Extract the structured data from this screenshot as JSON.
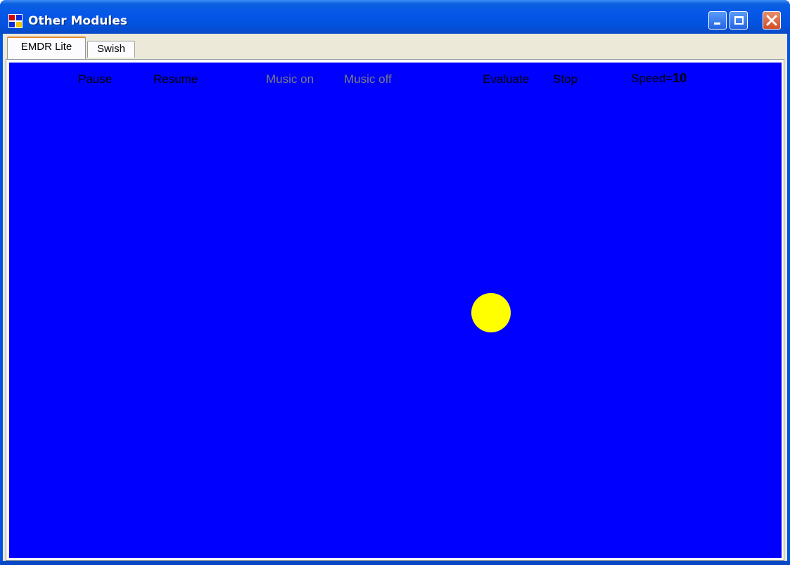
{
  "window": {
    "title": "Other Modules"
  },
  "tabs": [
    {
      "label": "EMDR Lite",
      "selected": true
    },
    {
      "label": "Swish",
      "selected": false
    }
  ],
  "controls": {
    "pause": "Pause",
    "resume": "Resume",
    "music_on": "Music on",
    "music_off": "Music off",
    "evaluate": "Evaluate",
    "stop": "Stop",
    "speed_label": "Speed=",
    "speed_value": "10"
  },
  "colors": {
    "panel_background": "#0000ff",
    "ball": "#ffff00",
    "disabled_text": "#7b7b7b"
  },
  "icons": {
    "app": "application-icon",
    "minimize": "minimize-icon",
    "maximize": "maximize-icon",
    "close": "close-icon"
  }
}
